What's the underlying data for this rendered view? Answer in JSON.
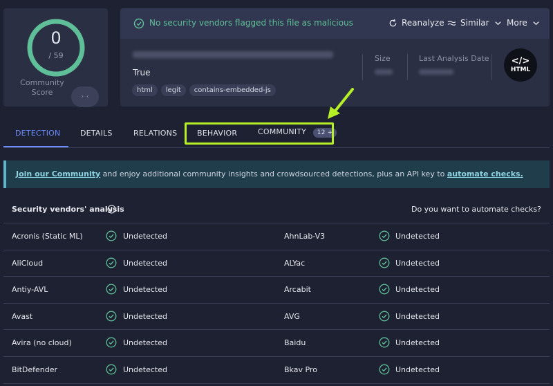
{
  "score": {
    "value": "0",
    "total": "/ 59",
    "label": "Community Score"
  },
  "banner": {
    "text": "No security vendors flagged this file as malicious"
  },
  "actions": {
    "reanalyze": "Reanalyze",
    "similar": "Similar",
    "more": "More"
  },
  "file": {
    "name": "True",
    "tags": [
      "html",
      "legit",
      "contains-embedded-js"
    ],
    "size_label": "Size",
    "date_label": "Last Analysis Date",
    "type_badge": "HTML",
    "type_glyph": "</>"
  },
  "tabs": {
    "detection": "DETECTION",
    "details": "DETAILS",
    "relations": "RELATIONS",
    "behavior": "BEHAVIOR",
    "community": "COMMUNITY",
    "community_count": "12 +"
  },
  "join": {
    "link1": "Join our Community",
    "middle": " and enjoy additional community insights and crowdsourced detections, plus an API key to ",
    "link2": "automate checks."
  },
  "vendors": {
    "title": "Security vendors' analysis",
    "automate": "Do you want to automate checks?",
    "rows": [
      {
        "left": "Acronis (Static ML)",
        "left_result": "Undetected",
        "right": "AhnLab-V3",
        "right_result": "Undetected"
      },
      {
        "left": "AliCloud",
        "left_result": "Undetected",
        "right": "ALYac",
        "right_result": "Undetected"
      },
      {
        "left": "Antiy-AVL",
        "left_result": "Undetected",
        "right": "Arcabit",
        "right_result": "Undetected"
      },
      {
        "left": "Avast",
        "left_result": "Undetected",
        "right": "AVG",
        "right_result": "Undetected"
      },
      {
        "left": "Avira (no cloud)",
        "left_result": "Undetected",
        "right": "Baidu",
        "right_result": "Undetected"
      },
      {
        "left": "BitDefender",
        "left_result": "Undetected",
        "right": "Bkav Pro",
        "right_result": "Undetected"
      }
    ]
  },
  "colors": {
    "accent": "#6c8cff",
    "ok": "#5fbf98",
    "highlight": "#b7f027",
    "ring": "#5fbf98"
  }
}
